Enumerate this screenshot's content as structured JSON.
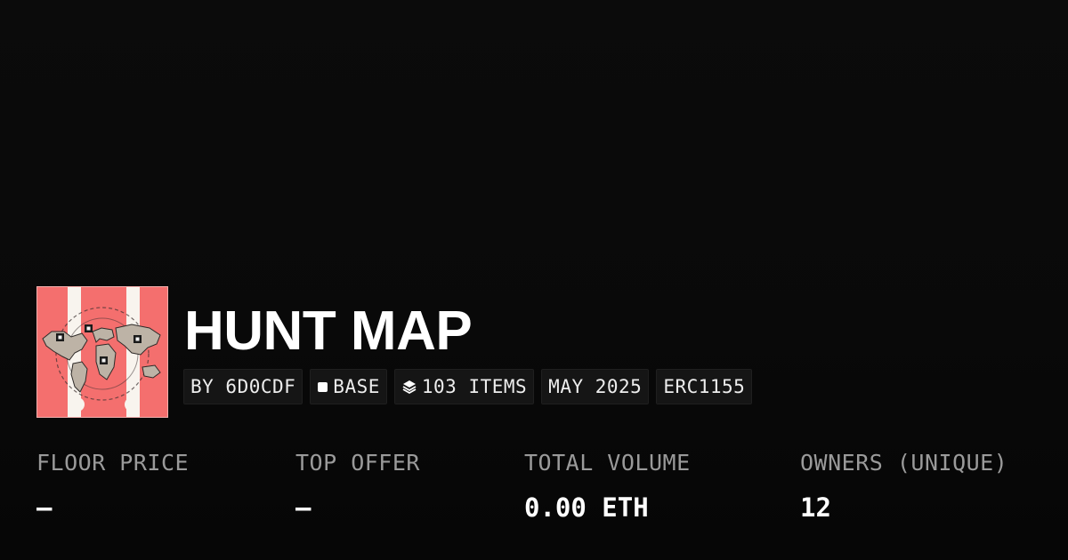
{
  "collection": {
    "name": "HUNT MAP",
    "image_icon": "treasure-map-artwork",
    "accent_color": "#f46f6e"
  },
  "tags": {
    "creator": "BY 6D0CDF",
    "chain": "BASE",
    "items": "103 ITEMS",
    "date": "MAY 2025",
    "standard": "ERC1155"
  },
  "stats": {
    "floor_price": {
      "label": "FLOOR PRICE",
      "value": "—"
    },
    "top_offer": {
      "label": "TOP OFFER",
      "value": "—"
    },
    "total_volume": {
      "label": "TOTAL VOLUME",
      "value": "0.00 ETH"
    },
    "owners": {
      "label": "OWNERS (UNIQUE)",
      "value": "12"
    }
  }
}
